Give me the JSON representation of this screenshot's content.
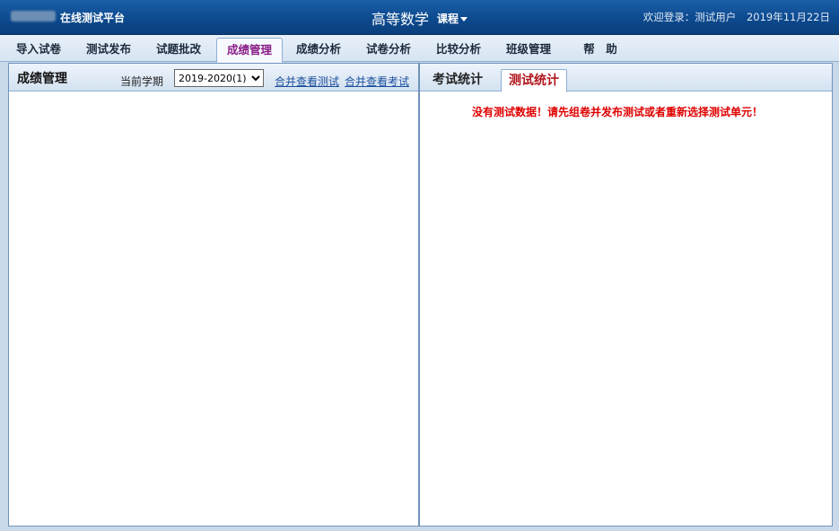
{
  "header": {
    "brand": "在线测试平台",
    "course_name": "高等数学",
    "course_menu": "课程",
    "welcome": "欢迎登录：测试用户",
    "date": "2019年11月22日"
  },
  "nav": {
    "items": [
      "导入试卷",
      "测试发布",
      "试题批改",
      "成绩管理",
      "成绩分析",
      "试卷分析",
      "比较分析",
      "班级管理",
      "帮　助"
    ],
    "active": "成绩管理"
  },
  "left_panel": {
    "title": "成绩管理",
    "term_label": "当前学期",
    "term_value": "2019-2020(1)",
    "link_merge_tests": "合并查看测试",
    "link_merge_exams": "合并查看考试"
  },
  "right_panel": {
    "tabs": [
      "考试统计",
      "测试统计"
    ],
    "active_tab": "测试统计",
    "message": "没有测试数据！请先组卷并发布测试或者重新选择测试单元！"
  },
  "colors": {
    "header_bg": "#0d4a8e",
    "active_nav": "#8a1f88",
    "alert": "#e00000"
  }
}
